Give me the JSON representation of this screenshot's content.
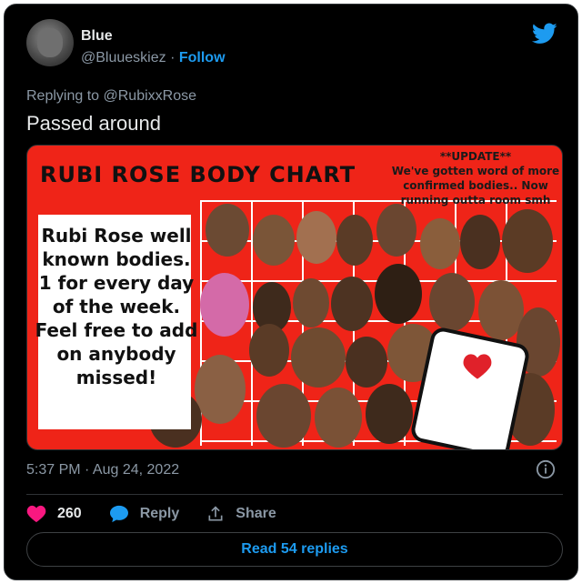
{
  "user": {
    "name": "Blue",
    "handle": "@Bluueskiez",
    "separator": "·",
    "follow_label": "Follow"
  },
  "tweet": {
    "replying_to": "Replying to @RubixxRose",
    "text": "Passed around"
  },
  "media": {
    "chart_title": "RUBI ROSE BODY CHART",
    "update_title": "**UPDATE**",
    "update_text": "We've gotten word of more confirmed bodies.. Now running outta room smh",
    "body_lines": [
      "Rubi Rose well",
      "known bodies.",
      "1 for every day",
      "of the week.",
      "Feel free to add",
      "on anybody",
      "missed!"
    ]
  },
  "meta": {
    "timestamp": "5:37 PM · Aug 24, 2022"
  },
  "actions": {
    "like_count": "260",
    "reply_label": "Reply",
    "share_label": "Share"
  },
  "read_replies_label": "Read 54 replies",
  "colors": {
    "accent": "#1d9bf0",
    "like": "#f91880",
    "reply_icon": "#1d9bf0",
    "chart_bg": "#ef2418"
  },
  "icons": {
    "brand": "twitter-bird-icon",
    "info": "info-icon",
    "like": "heart-icon",
    "reply": "speech-bubble-icon",
    "share": "share-icon"
  }
}
